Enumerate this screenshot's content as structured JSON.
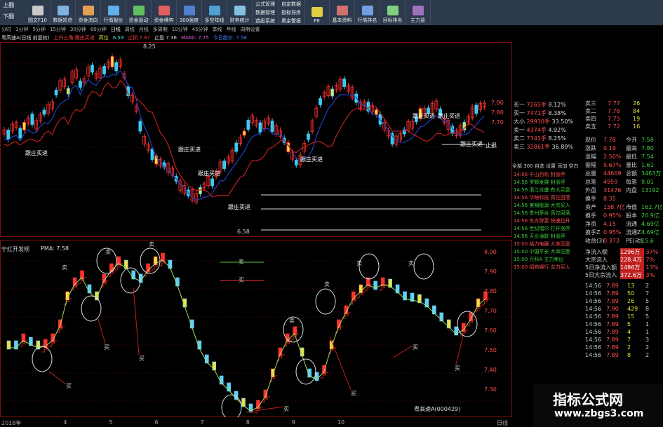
{
  "toolbar": {
    "left_top": "上翻",
    "left_bottom": "下翻",
    "buttons": [
      "图文F10",
      "数据短信",
      "资金流向",
      "行情报价",
      "资金驱动",
      "资金博弈",
      "300强度",
      "多空阵线",
      "财务统计",
      "选股"
    ],
    "stack1": [
      "公式管理",
      "数据管理",
      "选股系统"
    ],
    "stack2": [
      "自定数据",
      "指标排序",
      "周多窗口",
      "黑金警报"
    ],
    "tail": [
      "F8",
      "基本资料",
      "行情排名",
      "目标排名",
      "主力监"
    ]
  },
  "period_bar": [
    "分时",
    "1分钟",
    "5分钟",
    "15分钟",
    "30分钟",
    "60分钟",
    "日线",
    "周线",
    "月线",
    "多周期",
    "10分钟",
    "45分钟",
    "季线",
    "年线",
    "周期设置"
  ],
  "info_bar": {
    "stock": "粤高速A(日线 前复权)",
    "signal": "上升三角 跟庄买进",
    "ma_label": "高位",
    "values": "6.59",
    "zhi_sun": "止损 7.87",
    "zhi_ying": "止盈 7.36",
    "ma60": "MA60: 7.75",
    "other": "今日股价: 7.58"
  },
  "main_chart": {
    "labels": [
      "8.25",
      "6.58",
      "跟庄买进",
      "跟庄买进",
      "跟庄买进",
      "跟庄买进",
      "跟庄买进",
      "止损"
    ],
    "price_axis": [
      "7.90",
      "7.80",
      "7.70",
      "7.60",
      "7.50"
    ]
  },
  "sub_chart": {
    "title": "宁红开发规",
    "pma": "PMA: 7.58",
    "pma_value": "7.58",
    "buy_label": "买",
    "sell_label": "卖",
    "stock_code": "粤高速A(000429)",
    "legend_sell": "卖",
    "legend_buy": "买",
    "axis": [
      "8.00",
      "7.90",
      "7.80",
      "7.70",
      "7.60",
      "7.50",
      "7.40",
      "7.30"
    ],
    "x_ticks": [
      "2018年",
      "4",
      "5",
      "6",
      "7",
      "8",
      "9",
      "10"
    ]
  },
  "order_book": {
    "sell": [
      {
        "label": "卖三",
        "price": "7.77",
        "vol": "26"
      },
      {
        "label": "卖二",
        "price": "7.76",
        "vol": "84"
      },
      {
        "label": "卖四",
        "price": "7.75",
        "vol": "19"
      },
      {
        "label": "卖五",
        "price": "7.72",
        "vol": "16"
      }
    ],
    "stats": [
      {
        "k": "现价",
        "v": "7.78",
        "k2": "今开",
        "v2": "7.58"
      },
      {
        "k": "涨跌",
        "v": "0.19",
        "k2": "最高",
        "v2": "7.80"
      },
      {
        "k": "涨幅",
        "v": "2.50%",
        "k2": "最低",
        "v2": "7.54"
      },
      {
        "k": "振幅",
        "v": "5.67%",
        "k2": "量比",
        "v2": "1.61"
      },
      {
        "k": "总量",
        "v": "44669",
        "k2": "总额",
        "v2": "3463万"
      },
      {
        "k": "总笔",
        "v": "4959",
        "k2": "每笔",
        "v2": "9.01"
      },
      {
        "k": "外盘",
        "v": "31476",
        "k2": "内盘",
        "v2": "13192"
      },
      {
        "k": "换手",
        "v": "8.35",
        "k2": "",
        "v2": ""
      },
      {
        "k": "资产",
        "v": "158.7亿",
        "k2": "市值",
        "v2": "162.7亿"
      },
      {
        "k": "换手",
        "v": "0.95%",
        "k2": "股本",
        "v2": "20.9亿"
      },
      {
        "k": "净资",
        "v": "4.15",
        "k2": "流通",
        "v2": "4.69亿"
      },
      {
        "k": "换手Z",
        "v": "0.95%",
        "k2": "流通Z",
        "v2": "4.69亿"
      },
      {
        "k": "收益(3)",
        "v": "0.373",
        "k2": "PE(动)",
        "v2": "15.6"
      }
    ],
    "flow": [
      {
        "k": "净流入额",
        "v": "1296万",
        "p": "37%"
      },
      {
        "k": "大宗流入",
        "v": "228.4万",
        "p": "7%"
      },
      {
        "k": "5日净流入额",
        "v": "1486万",
        "p": "13%"
      },
      {
        "k": "5日大宗流入",
        "v": "372.6万",
        "p": "3%"
      }
    ],
    "ticks": [
      {
        "t": "14:56",
        "p": "7.89",
        "v": "13",
        "n": "2"
      },
      {
        "t": "14:56",
        "p": "7.89",
        "v": "50",
        "n": "7"
      },
      {
        "t": "14:56",
        "p": "7.89",
        "v": "26",
        "n": "5"
      },
      {
        "t": "14:56",
        "p": "7.90",
        "v": "429",
        "n": "8"
      },
      {
        "t": "14:56",
        "p": "7.89",
        "v": "15",
        "n": "5"
      },
      {
        "t": "14:56",
        "p": "7.89",
        "v": "5",
        "n": "1"
      },
      {
        "t": "14:56",
        "p": "7.89",
        "v": "4",
        "n": "1"
      },
      {
        "t": "14:56",
        "p": "7.89",
        "v": "7",
        "n": "3"
      },
      {
        "t": "14:56",
        "p": "7.89",
        "v": "2",
        "n": "2"
      },
      {
        "t": "14:56",
        "p": "7.89",
        "v": "8",
        "n": "2"
      }
    ]
  },
  "mini_panel": {
    "rows": [
      {
        "k": "买一",
        "v": "7265手",
        "p": "8.12%"
      },
      {
        "k": "买一",
        "v": "7471手",
        "p": "8.38%"
      },
      {
        "k": "大小",
        "v": "29930手",
        "p": "33.50%"
      },
      {
        "k": "卖一",
        "v": "4374手",
        "p": "4.92%"
      },
      {
        "k": "卖二",
        "v": "7341手",
        "p": "8.25%"
      },
      {
        "k": "卖三",
        "v": "32861手",
        "p": "36.89%"
      }
    ],
    "tabs": "全部 300 自选 设置 添加 空白"
  },
  "news": [
    "14:56 千山药机 封涨停",
    "14:56 罗顿发展 封涨停",
    "14:56 浙江龙盛 有大买盘",
    "14:56 华映科技 高位回落",
    "14:56 美锦能源 大宗买入",
    "14:56 贵州茅台 高位回落",
    "14:56 东方财富 快速拉升",
    "14:56 世纪瑞尔 打开涨停",
    "14:56 天业通联 封涨停",
    "15:00 格力电器 大单压盘",
    "15:00 中国平安 大单压盘",
    "15:00 万科A 主力卖出",
    "15:00 招商银行 主力买入"
  ],
  "watermark": {
    "title": "指标公式网",
    "url": "www.zbgs3.com"
  },
  "bottom_label": "日线"
}
